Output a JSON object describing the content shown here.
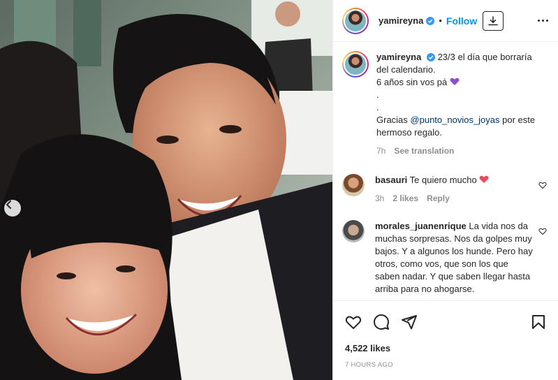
{
  "post": {
    "username": "yamireyna",
    "follow_label": "Follow",
    "separator": "•",
    "caption": {
      "username": "yamireyna",
      "line1": "23/3 el día que borraría del calendario.",
      "line2": "6 años sin vos pá",
      "line3": ".",
      "line4": ".",
      "line5_prefix": "Gracias ",
      "mention": "@punto_novios_joyas",
      "line5_suffix": " por este hermoso regalo.",
      "age": "7h",
      "translate": "See translation"
    },
    "comments": [
      {
        "username": "basauri",
        "text": "Te quiero mucho",
        "age": "3h",
        "likes": "2 likes",
        "reply": "Reply"
      },
      {
        "username": "morales_juanenrique",
        "text": "La vida nos da muchas sorpresas. Nos da golpes muy bajos. Y a algunos los hunde. Pero hay otros, como vos, que son los que saben nadar. Y que saben llegar hasta arriba para no ahogarse."
      }
    ],
    "likes": "4,522 likes",
    "timestamp": "7 HOURS AGO"
  },
  "icons": {
    "verified": "verified-badge-icon",
    "download": "download-icon",
    "more": "more-options-icon",
    "like": "heart-icon",
    "comment": "comment-icon",
    "share": "share-icon",
    "save": "bookmark-icon",
    "prev": "chevron-left-icon"
  },
  "colors": {
    "accent": "#0095f6",
    "verified": "#3897f0",
    "mention": "#00376b",
    "muted": "#8e8e8e",
    "heart": "#ed4956",
    "purple_heart": "#8a4fd1"
  }
}
